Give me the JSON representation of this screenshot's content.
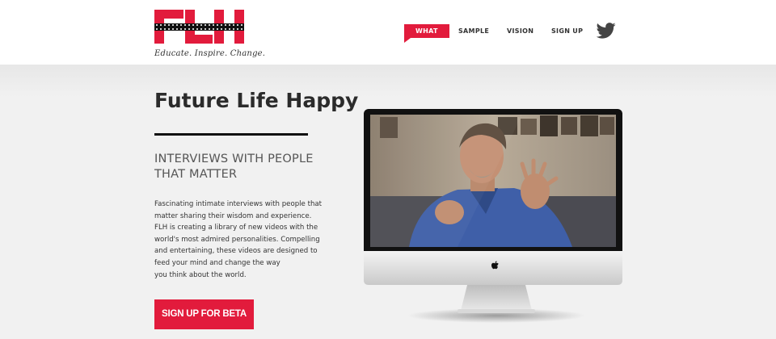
{
  "brand": {
    "logo_text": "FLH",
    "tagline": "Educate. Inspire. Change.",
    "accent_color": "#e21b3c"
  },
  "nav": {
    "items": [
      {
        "label": "WHAT",
        "active": true
      },
      {
        "label": "SAMPLE",
        "active": false
      },
      {
        "label": "VISION",
        "active": false
      },
      {
        "label": "SIGN UP",
        "active": false
      }
    ],
    "twitter_icon": "twitter-bird-icon"
  },
  "hero": {
    "title": "Future Life Happy",
    "subtitle_line1": "INTERVIEWS WITH PEOPLE",
    "subtitle_line2": "THAT MATTER",
    "body_lines": [
      "Fascinating intimate interviews with people that",
      "matter sharing their wisdom and experience.",
      "FLH is creating a library of new videos with the",
      "world's most admired personalities. Compelling",
      "and entertaining, these videos are designed to",
      "feed your mind and change the way",
      "you think about the world."
    ],
    "cta_label": "SIGN UP FOR BETA"
  },
  "media": {
    "device": "imac-monitor",
    "logo_icon": "apple-logo-icon"
  }
}
